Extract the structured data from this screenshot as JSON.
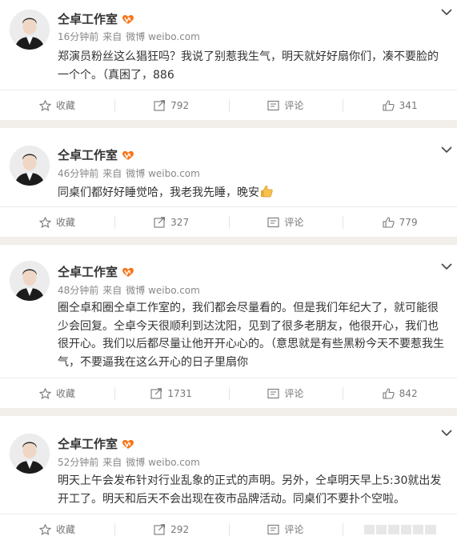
{
  "account": {
    "name": "仝卓工作室"
  },
  "colors": {
    "vip_badge": "#f77519",
    "name": "#333333",
    "meta": "#888888",
    "separator": "#f2eee9"
  },
  "actions": {
    "favorite_label": "收藏",
    "comment_label": "评论"
  },
  "posts": [
    {
      "time": "16分钟前",
      "source_prefix": "来自",
      "source_app": "微博 weibo.com",
      "text": "郑演员粉丝这么猖狂吗？我说了别惹我生气，明天就好好扇你们，凑不要脸的一个个。（真困了，886",
      "reposts": "792",
      "likes": "341"
    },
    {
      "time": "46分钟前",
      "source_prefix": "来自",
      "source_app": "微博 weibo.com",
      "text": "同桌们都好好睡觉哈，我老我先睡，晚安",
      "emoji": "thumbs-up-emoji",
      "reposts": "327",
      "likes": "779"
    },
    {
      "time": "48分钟前",
      "source_prefix": "来自",
      "source_app": "微博 weibo.com",
      "text": "圈仝卓和圈仝卓工作室的，我们都会尽量看的。但是我们年纪大了，就可能很少会回复。仝卓今天很顺利到达沈阳，见到了很多老朋友，他很开心，我们也很开心。我们以后都尽量让他开开心心的。（意思就是有些黑粉今天不要惹我生气，不要逼我在这么开心的日子里扇你",
      "reposts": "1731",
      "likes": "842"
    },
    {
      "time": "52分钟前",
      "source_prefix": "来自",
      "source_app": "微博 weibo.com",
      "text": "明天上午会发布针对行业乱象的正式的声明。另外，仝卓明天早上5:30就出发开工了。明天和后天不会出现在夜市品牌活动。同桌们不要扑个空啦。",
      "reposts": "292",
      "likes": ""
    }
  ]
}
